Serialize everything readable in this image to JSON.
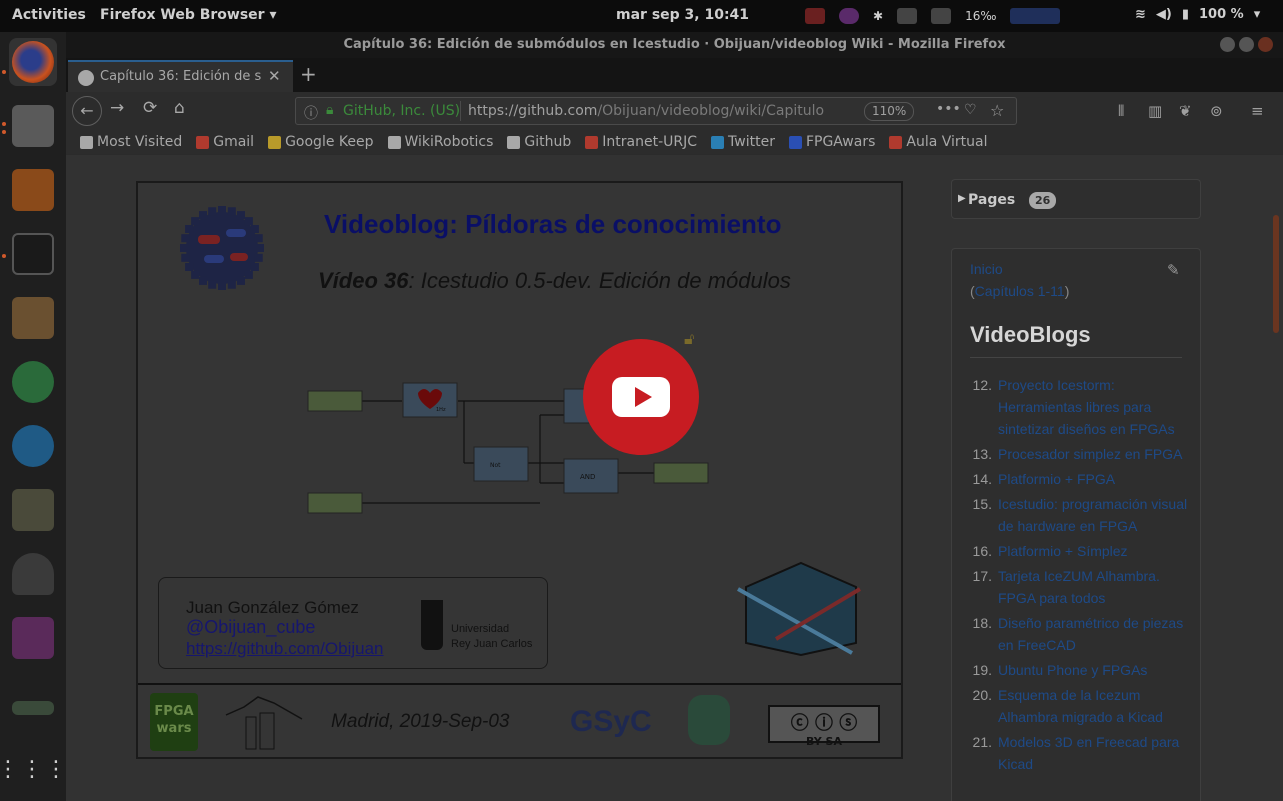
{
  "topbar": {
    "activities": "Activities",
    "app_menu": "Firefox Web Browser ▾",
    "clock": "mar sep  3, 10:41",
    "battery": "100 %",
    "tray_small": "16‰"
  },
  "window": {
    "title": "Capítulo 36: Edición de submódulos en Icestudio · Obijuan/videoblog Wiki - Mozilla Firefox"
  },
  "tab": {
    "label": "Capítulo 36: Edición de s",
    "close": "✕",
    "new_tab": "+"
  },
  "nav": {
    "back": "←",
    "forward": "→",
    "reload": "⟳",
    "home": "⌂",
    "site_identity": "GitHub, Inc. (US)",
    "url_host": "https://github.com",
    "url_path": "/Obijuan/videoblog/wiki/Capitulo",
    "zoom": "110%",
    "more": "•••"
  },
  "bookmarks": [
    {
      "label": "Most Visited",
      "icon": "gear-icon",
      "color": "#a8a8a8"
    },
    {
      "label": "Gmail",
      "icon": "gmail-icon",
      "color": "#b03a2e"
    },
    {
      "label": "Google Keep",
      "icon": "keep-icon",
      "color": "#b89a2a"
    },
    {
      "label": "WikiRobotics",
      "icon": "globe-icon",
      "color": "#a8a8a8"
    },
    {
      "label": "Github",
      "icon": "github-icon",
      "color": "#a8a8a8"
    },
    {
      "label": "Intranet-URJC",
      "icon": "urjc-icon",
      "color": "#b03a2e"
    },
    {
      "label": "Twitter",
      "icon": "twitter-icon",
      "color": "#2a7fb4"
    },
    {
      "label": "FPGAwars",
      "icon": "fpgawars-icon",
      "color": "#2a4fb4"
    },
    {
      "label": "Aula Virtual",
      "icon": "urjc-icon",
      "color": "#b03a2e"
    }
  ],
  "video": {
    "heading": "Videoblog: Píldoras de conocimiento",
    "subtitle_bold": "Vídeo 36",
    "subtitle_rest": ": Icestudio 0.5-dev. Edición de módulos",
    "author": "Juan González Gómez",
    "handle": "@Obijuan_cube",
    "github": "https://github.com/Obijuan",
    "uni_line1": "Universidad",
    "uni_line2": "Rey Juan Carlos",
    "footer_place": "Madrid, 2019-Sep-03",
    "footer_logo_text": "GSyC",
    "fpgawars_text": "FPGA wars",
    "license_text": "BY SA",
    "gate_not": "Not",
    "gate_and": "AND",
    "heart_label": "1Hz"
  },
  "sidebar": {
    "pages_label": "Pages",
    "pages_count": "26",
    "inicio": "Inicio",
    "capitulos_open": "(",
    "capitulos": "Capítulos 1-11",
    "capitulos_close": ")",
    "videoblogs_heading": "VideoBlogs",
    "items": [
      {
        "num": "12.",
        "label": "Proyecto Icestorm: Herramientas libres para sintetizar diseños en FPGAs"
      },
      {
        "num": "13.",
        "label": "Procesador simplez en FPGA"
      },
      {
        "num": "14.",
        "label": "Platformio + FPGA"
      },
      {
        "num": "15.",
        "label": "Icestudio: programación visual de hardware en FPGA"
      },
      {
        "num": "16.",
        "label": "Platformio + Símplez"
      },
      {
        "num": "17.",
        "label": "Tarjeta IceZUM Alhambra. FPGA para todos"
      },
      {
        "num": "18.",
        "label": "Diseño paramétrico de piezas en FreeCAD"
      },
      {
        "num": "19.",
        "label": "Ubuntu Phone y FPGAs"
      },
      {
        "num": "20.",
        "label": "Esquema de la Icezum Alhambra migrado a Kicad"
      },
      {
        "num": "21.",
        "label": "Modelos 3D en Freecad para Kicad"
      }
    ]
  },
  "colors": {
    "play_button": "#c71c22",
    "link": "#1e4a87",
    "heading_blue": "#0a0f66"
  }
}
